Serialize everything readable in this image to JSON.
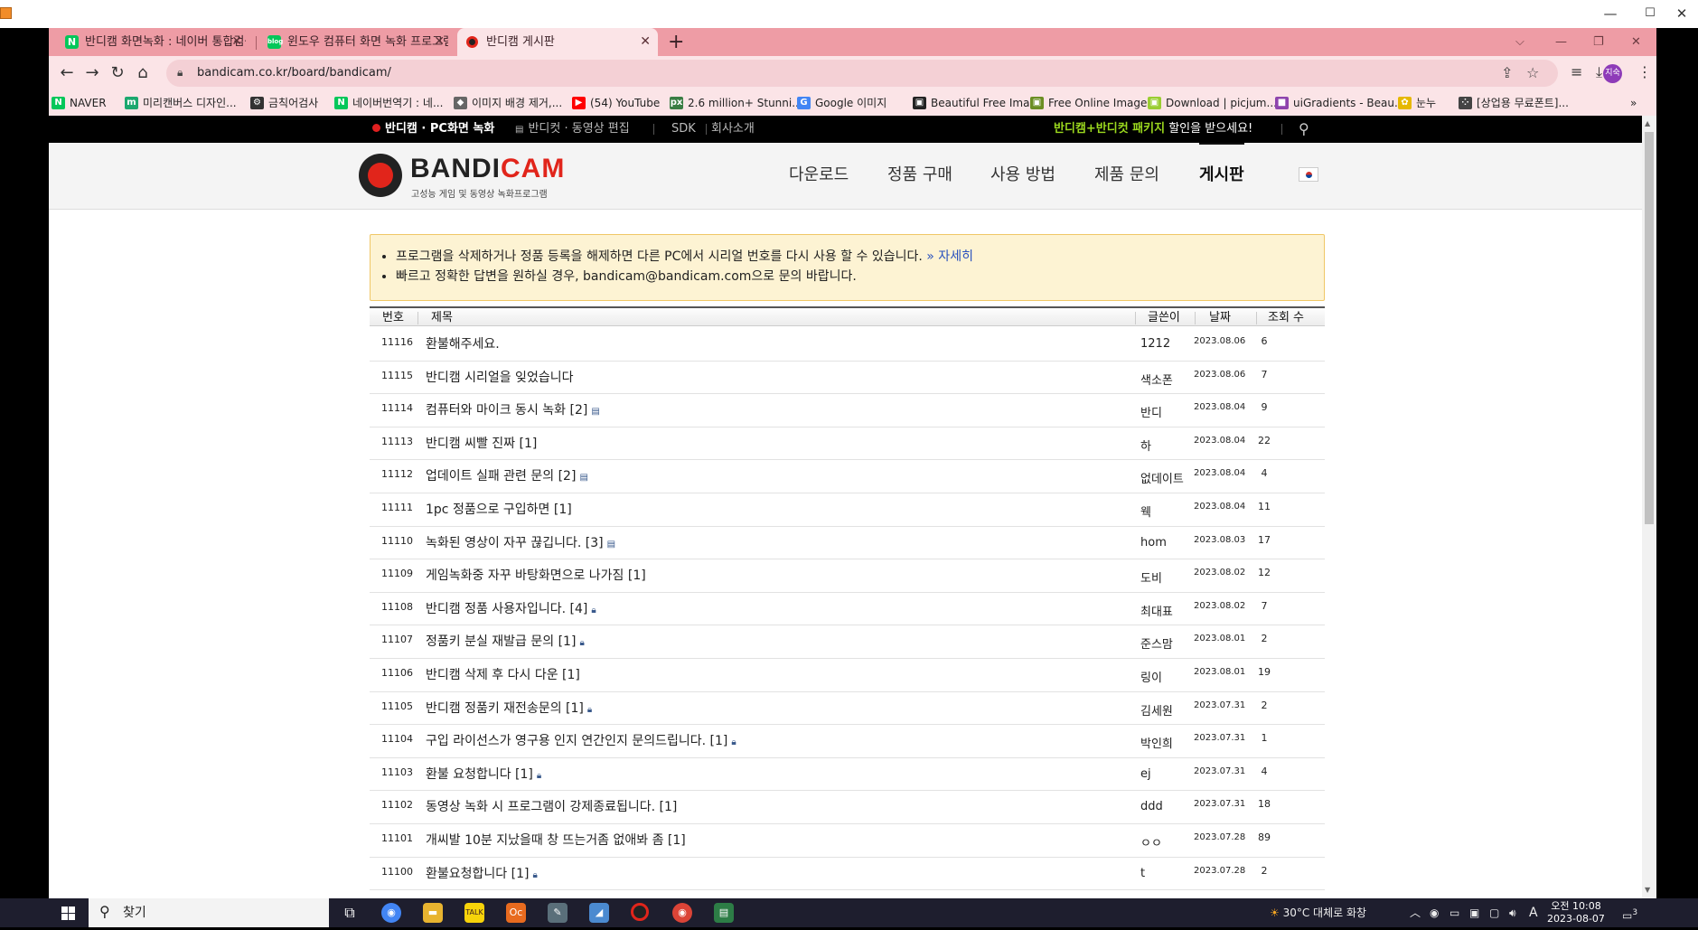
{
  "window": {
    "minimize": "—",
    "maximize": "☐",
    "close": "✕"
  },
  "tabs": [
    {
      "title": "반디캠 화면녹화 : 네이버 통합검색",
      "icon": "naver-icon",
      "color": "#03c75a"
    },
    {
      "title": "윈도우 컴퓨터 화면 녹화 프로그램",
      "icon": "blog-icon",
      "color": "#03c75a"
    },
    {
      "title": "반디캠 게시판",
      "icon": "bandicam-icon",
      "color": "#e1251b"
    }
  ],
  "toolbar": {
    "url": "bandicam.co.kr/board/bandicam/",
    "profile": "지숙"
  },
  "bookmarks": [
    {
      "label": "NAVER",
      "color": "#03c75a",
      "glyph": "N"
    },
    {
      "label": "미리캔버스 디자인...",
      "color": "#1ca86f",
      "glyph": "m"
    },
    {
      "label": "금칙어검사",
      "color": "#333333",
      "glyph": "⚙"
    },
    {
      "label": "네이버번역기 : 네...",
      "color": "#03c75a",
      "glyph": "N"
    },
    {
      "label": "이미지 배경 제거,...",
      "color": "#666666",
      "glyph": "◆"
    },
    {
      "label": "(54) YouTube",
      "color": "#ff0000",
      "glyph": "▶"
    },
    {
      "label": "2.6 million+ Stunni...",
      "color": "#3a7d44",
      "glyph": "px"
    },
    {
      "label": "Google 이미지",
      "color": "#4285f4",
      "glyph": "G"
    },
    {
      "label": "Beautiful Free Ima...",
      "color": "#222222",
      "glyph": "▣"
    },
    {
      "label": "Free Online Image...",
      "color": "#6b8e23",
      "glyph": "▣"
    },
    {
      "label": "Download | picjum...",
      "color": "#9acd32",
      "glyph": "▣"
    },
    {
      "label": "uiGradients - Beau...",
      "color": "#8e44ad",
      "glyph": "■"
    },
    {
      "label": "눈누",
      "color": "#e6b800",
      "glyph": "✿"
    },
    {
      "label": "[상업용 무료폰트]...",
      "color": "#444444",
      "glyph": "⁘"
    }
  ],
  "site": {
    "topbar": {
      "bandicam": "반디캠 · PC화면 녹화",
      "bandicut": "반디컷 · 동영상 편집",
      "sdk": "SDK",
      "company": "회사소개",
      "promo_highlight": "반디캠+반디컷 패키지",
      "promo_rest": " 할인을 받으세요!"
    },
    "brand_main": "BANDI",
    "brand_accent": "CAM",
    "brand_sub": "고성능 게임 및 동영상 녹화프로그램",
    "menu": [
      "다운로드",
      "정품 구매",
      "사용 방법",
      "제품 문의",
      "게시판"
    ]
  },
  "notice": {
    "line1": "프로그램을 삭제하거나 정품 등록을 해제하면 다른 PC에서 시리얼 번호를 다시 사용 할 수 있습니다.",
    "line1_link": " » 자세히",
    "line2": "빠르고 정확한 답변을 원하실 경우, bandicam@bandicam.com으로 문의 바랍니다."
  },
  "board": {
    "headers": {
      "no": "번호",
      "title": "제목",
      "author": "글쓴이",
      "date": "날짜",
      "views": "조회 수"
    },
    "rows": [
      {
        "no": "11116",
        "title": "환불해주세요.",
        "icon": "",
        "author": "1212",
        "date": "2023.08.06",
        "views": "6"
      },
      {
        "no": "11115",
        "title": "반디캠 시리얼을 잊었습니다",
        "icon": "",
        "author": "색소폰",
        "date": "2023.08.06",
        "views": "7"
      },
      {
        "no": "11114",
        "title": "컴퓨터와 마이크 동시 녹화 [2]",
        "icon": "file",
        "author": "반디",
        "date": "2023.08.04",
        "views": "9"
      },
      {
        "no": "11113",
        "title": "반디캠 씨빨 진짜 [1]",
        "icon": "",
        "author": "하",
        "date": "2023.08.04",
        "views": "22"
      },
      {
        "no": "11112",
        "title": "업데이트 실패 관련 문의 [2]",
        "icon": "file",
        "author": "없데이트",
        "date": "2023.08.04",
        "views": "4"
      },
      {
        "no": "11111",
        "title": "1pc 정품으로 구입하면 [1]",
        "icon": "",
        "author": "웩",
        "date": "2023.08.04",
        "views": "11"
      },
      {
        "no": "11110",
        "title": "녹화된 영상이 자꾸 끊깁니다. [3]",
        "icon": "file",
        "author": "hom",
        "date": "2023.08.03",
        "views": "17"
      },
      {
        "no": "11109",
        "title": "게임녹화중 자꾸 바탕화면으로 나가짐 [1]",
        "icon": "",
        "author": "도비",
        "date": "2023.08.02",
        "views": "12"
      },
      {
        "no": "11108",
        "title": "반디캠 정품 사용자입니다. [4]",
        "icon": "lock",
        "author": "최대표",
        "date": "2023.08.02",
        "views": "7"
      },
      {
        "no": "11107",
        "title": "정품키 분실 재발급 문의 [1]",
        "icon": "lock",
        "author": "준스맘",
        "date": "2023.08.01",
        "views": "2"
      },
      {
        "no": "11106",
        "title": "반디캠 삭제 후 다시 다운 [1]",
        "icon": "",
        "author": "링이",
        "date": "2023.08.01",
        "views": "19"
      },
      {
        "no": "11105",
        "title": "반디캠 정품키 재전송문의 [1]",
        "icon": "lock",
        "author": "김세원",
        "date": "2023.07.31",
        "views": "2"
      },
      {
        "no": "11104",
        "title": "구입 라이선스가 영구용 인지 연간인지 문의드립니다. [1]",
        "icon": "lock",
        "author": "박인희",
        "date": "2023.07.31",
        "views": "1"
      },
      {
        "no": "11103",
        "title": "환불 요청합니다 [1]",
        "icon": "lock",
        "author": "ej",
        "date": "2023.07.31",
        "views": "4"
      },
      {
        "no": "11102",
        "title": "동영상 녹화 시 프로그램이 강제종료됩니다. [1]",
        "icon": "",
        "author": "ddd",
        "date": "2023.07.31",
        "views": "18"
      },
      {
        "no": "11101",
        "title": "개씨발 10분 지났을때 창 뜨는거좀 없애봐 좀 [1]",
        "icon": "",
        "author": "ㅇㅇ",
        "date": "2023.07.28",
        "views": "89"
      },
      {
        "no": "11100",
        "title": "환불요청합니다 [1]",
        "icon": "lock",
        "author": "t",
        "date": "2023.07.28",
        "views": "2"
      }
    ]
  },
  "taskbar": {
    "search": "찾기",
    "weather": "30°C  대체로 화창",
    "time": "오전 10:08",
    "date": "2023-08-07",
    "notifications": "3"
  }
}
